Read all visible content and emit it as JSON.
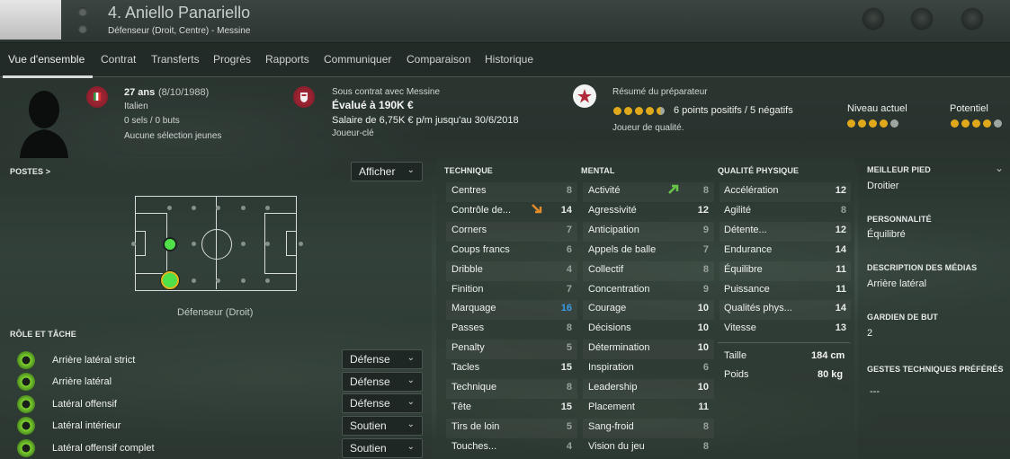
{
  "header": {
    "title": "4. Aniello Panariello",
    "subtitle": "Défenseur (Droit, Centre) - Messine"
  },
  "tabs": [
    {
      "label": "Vue d'ensemble",
      "active": true
    },
    {
      "label": "Contrat"
    },
    {
      "label": "Transferts"
    },
    {
      "label": "Progrès"
    },
    {
      "label": "Rapports"
    },
    {
      "label": "Communiquer"
    },
    {
      "label": "Comparaison"
    },
    {
      "label": "Historique"
    }
  ],
  "bio": {
    "age": "27 ans",
    "dob": "(8/10/1988)",
    "nationality": "Italien",
    "caps": "0 sels / 0 buts",
    "youth": "Aucune sélection jeunes"
  },
  "contract": {
    "club": "Sous contrat avec Messine",
    "value": "Évalué à 190K €",
    "salary": "Salaire de 6,75K € p/m jusqu'au 30/6/2018",
    "status": "Joueur-clé"
  },
  "coach": {
    "title": "Résumé du préparateur",
    "summary": "6 points positifs / 5 négatifs",
    "quality": "Joueur de qualité.",
    "stars": 4.5,
    "current_label": "Niveau actuel",
    "potential_label": "Potentiel",
    "current_stars": 4,
    "potential_stars": 4,
    "colors": {
      "gold": "#e0a91b",
      "grey": "#9ea6a2"
    }
  },
  "positions": {
    "title": "POSTES >",
    "show_label": "Afficher",
    "caption": "Défenseur (Droit)"
  },
  "roles": {
    "title": "RÔLE ET TÂCHE",
    "items": [
      {
        "role": "Arrière latéral strict",
        "duty": "Défense"
      },
      {
        "role": "Arrière latéral",
        "duty": "Défense"
      },
      {
        "role": "Latéral offensif",
        "duty": "Défense"
      },
      {
        "role": "Latéral intérieur",
        "duty": "Soutien"
      },
      {
        "role": "Latéral offensif complet",
        "duty": "Soutien"
      }
    ]
  },
  "technical": {
    "title": "TECHNIQUE",
    "items": [
      {
        "name": "Centres",
        "value": "8"
      },
      {
        "name": "Contrôle de...",
        "value": "14"
      },
      {
        "name": "Corners",
        "value": "7"
      },
      {
        "name": "Coups francs",
        "value": "6"
      },
      {
        "name": "Dribble",
        "value": "4"
      },
      {
        "name": "Finition",
        "value": "7"
      },
      {
        "name": "Marquage",
        "value": "16"
      },
      {
        "name": "Passes",
        "value": "8"
      },
      {
        "name": "Penalty",
        "value": "5"
      },
      {
        "name": "Tacles",
        "value": "15"
      },
      {
        "name": "Technique",
        "value": "8"
      },
      {
        "name": "Tête",
        "value": "15"
      },
      {
        "name": "Tirs de loin",
        "value": "5"
      },
      {
        "name": "Touches...",
        "value": "4"
      }
    ]
  },
  "mental": {
    "title": "MENTAL",
    "items": [
      {
        "name": "Activité",
        "value": "8"
      },
      {
        "name": "Agressivité",
        "value": "12"
      },
      {
        "name": "Anticipation",
        "value": "9"
      },
      {
        "name": "Appels de balle",
        "value": "7"
      },
      {
        "name": "Collectif",
        "value": "8"
      },
      {
        "name": "Concentration",
        "value": "9"
      },
      {
        "name": "Courage",
        "value": "10"
      },
      {
        "name": "Décisions",
        "value": "10"
      },
      {
        "name": "Détermination",
        "value": "10"
      },
      {
        "name": "Inspiration",
        "value": "6"
      },
      {
        "name": "Leadership",
        "value": "10"
      },
      {
        "name": "Placement",
        "value": "11"
      },
      {
        "name": "Sang-froid",
        "value": "8"
      },
      {
        "name": "Vision du jeu",
        "value": "8"
      }
    ]
  },
  "physical": {
    "title": "QUALITÉ PHYSIQUE",
    "items": [
      {
        "name": "Accélération",
        "value": "12"
      },
      {
        "name": "Agilité",
        "value": "8"
      },
      {
        "name": "Détente...",
        "value": "12"
      },
      {
        "name": "Endurance",
        "value": "14"
      },
      {
        "name": "Équilibre",
        "value": "11"
      },
      {
        "name": "Puissance",
        "value": "11"
      },
      {
        "name": "Qualités phys...",
        "value": "14"
      },
      {
        "name": "Vitesse",
        "value": "13"
      }
    ],
    "height_label": "Taille",
    "height": "184 cm",
    "weight_label": "Poids",
    "weight": "80 kg"
  },
  "details": {
    "foot_title": "MEILLEUR PIED",
    "foot": "Droitier",
    "personality_title": "PERSONNALITÉ",
    "personality": "Équilibré",
    "media_title": "DESCRIPTION DES MÉDIAS",
    "media": "Arrière latéral",
    "gk_title": "GARDIEN DE BUT",
    "gk": "2",
    "traits_title": "GESTES TECHNIQUES PRÉFÉRÉS",
    "traits": "---"
  }
}
